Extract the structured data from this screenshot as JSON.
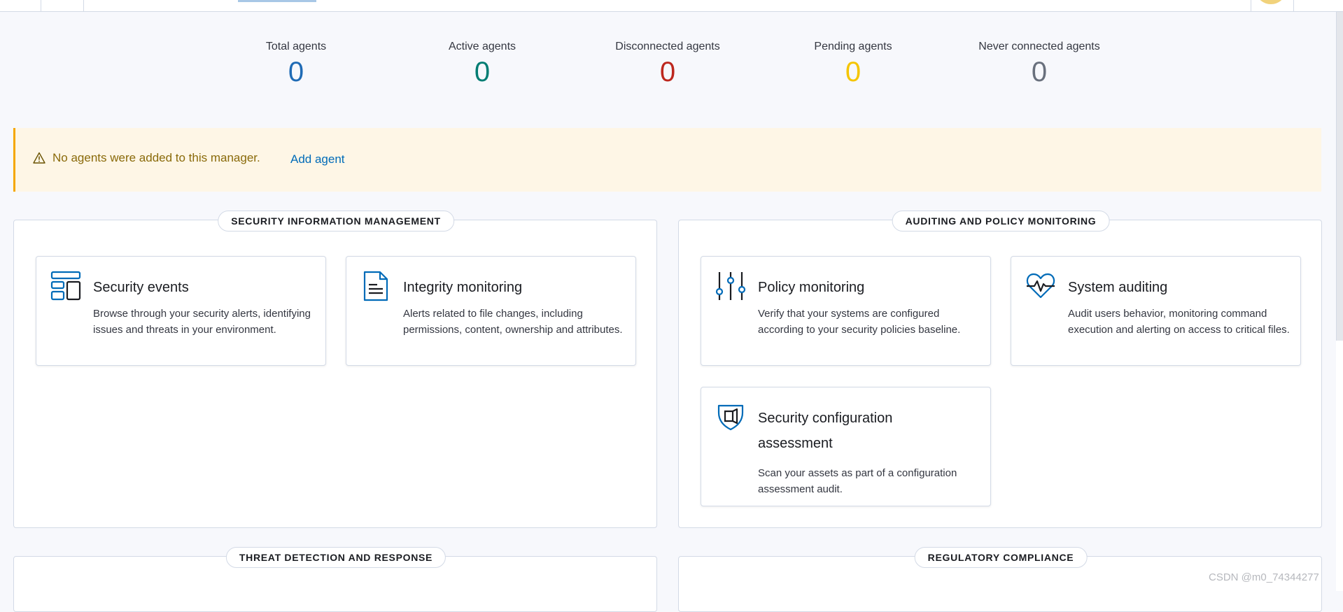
{
  "stats": [
    {
      "label": "Total agents",
      "value": "0",
      "color": "#1f6bb5"
    },
    {
      "label": "Active agents",
      "value": "0",
      "color": "#017d73"
    },
    {
      "label": "Disconnected agents",
      "value": "0",
      "color": "#bd271e"
    },
    {
      "label": "Pending agents",
      "value": "0",
      "color": "#f5c500"
    },
    {
      "label": "Never connected agents",
      "value": "0",
      "color": "#69707d"
    }
  ],
  "callout": {
    "message": "No agents were added to this manager.",
    "link": "Add agent",
    "icon": "warning-icon"
  },
  "panels": {
    "sim": {
      "title": "SECURITY INFORMATION MANAGEMENT",
      "cards": [
        {
          "title": "Security events",
          "desc": "Browse through your security alerts, identifying issues and threats in your environment.",
          "icon": "dashboard-icon"
        },
        {
          "title": "Integrity monitoring",
          "desc": "Alerts related to file changes, including permissions, content, ownership and attributes.",
          "icon": "document-icon"
        }
      ]
    },
    "apm": {
      "title": "AUDITING AND POLICY MONITORING",
      "cards": [
        {
          "title": "Policy monitoring",
          "desc": "Verify that your systems are configured according to your security policies baseline.",
          "icon": "sliders-icon"
        },
        {
          "title": "System auditing",
          "desc": "Audit users behavior, monitoring command execution and alerting on access to critical files.",
          "icon": "heartbeat-icon"
        },
        {
          "title": "Security configuration assessment",
          "desc": "Scan your assets as part of a configuration assessment audit.",
          "icon": "shield-icon"
        }
      ]
    },
    "tdr": {
      "title": "THREAT DETECTION AND RESPONSE"
    },
    "rc": {
      "title": "REGULATORY COMPLIANCE"
    }
  },
  "watermark": "CSDN @m0_74344277"
}
